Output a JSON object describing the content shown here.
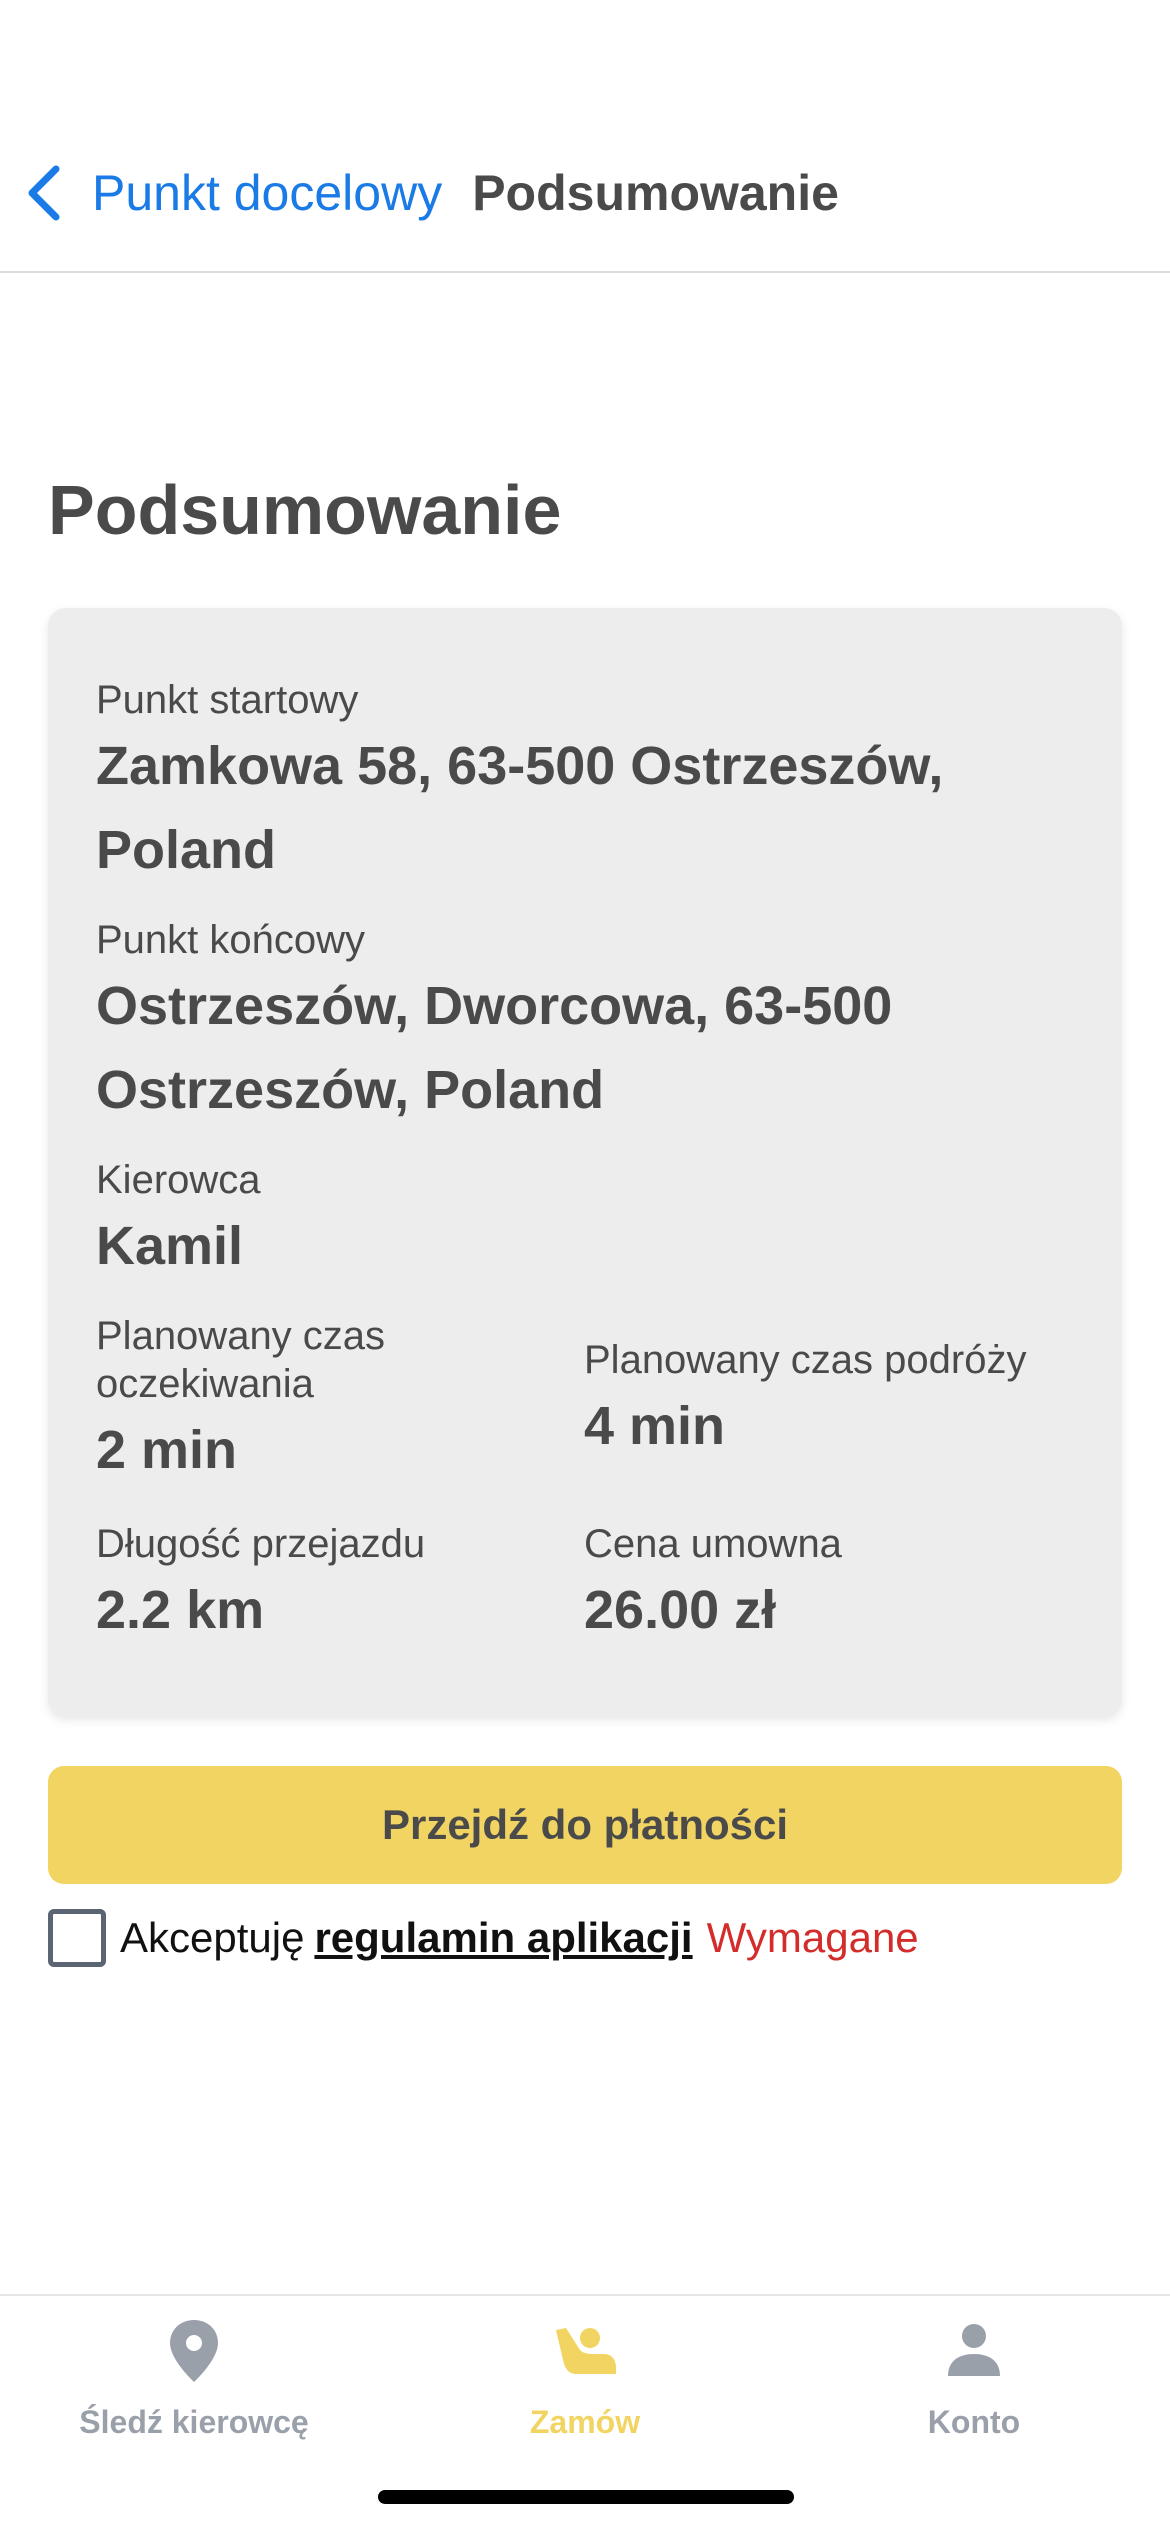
{
  "nav": {
    "back_label": "Punkt docelowy",
    "title": "Podsumowanie"
  },
  "heading": "Podsumowanie",
  "summary": {
    "start": {
      "label": "Punkt startowy",
      "value": "Zamkowa 58, 63-500 Ostrzeszów, Poland"
    },
    "end": {
      "label": "Punkt końcowy",
      "value": "Ostrzeszów, Dworcowa, 63-500 Ostrzeszów, Poland"
    },
    "driver": {
      "label": "Kierowca",
      "value": "Kamil"
    },
    "wait_time": {
      "label": "Planowany czas oczekiwania",
      "value": "2 min"
    },
    "travel_time": {
      "label": "Planowany czas podróży",
      "value": "4 min"
    },
    "distance": {
      "label": "Długość przejazdu",
      "value": "2.2 km"
    },
    "price": {
      "label": "Cena umowna",
      "value": "26.00 zł"
    }
  },
  "pay_button": "Przejdź do płatności",
  "terms": {
    "prefix": "Akceptuję",
    "link": "regulamin aplikacji",
    "required": "Wymagane",
    "checked": false
  },
  "tabs": [
    {
      "label": "Śledź kierowcę",
      "icon": "location-pin-icon",
      "active": false
    },
    {
      "label": "Zamów",
      "icon": "hailing-person-icon",
      "active": true
    },
    {
      "label": "Konto",
      "icon": "person-icon",
      "active": false
    }
  ],
  "colors": {
    "accent_blue": "#1a7ae6",
    "button_yellow": "#f2d462",
    "required_red": "#d42b2b",
    "card_bg": "#ededed",
    "tab_inactive": "#9aa0aa"
  }
}
